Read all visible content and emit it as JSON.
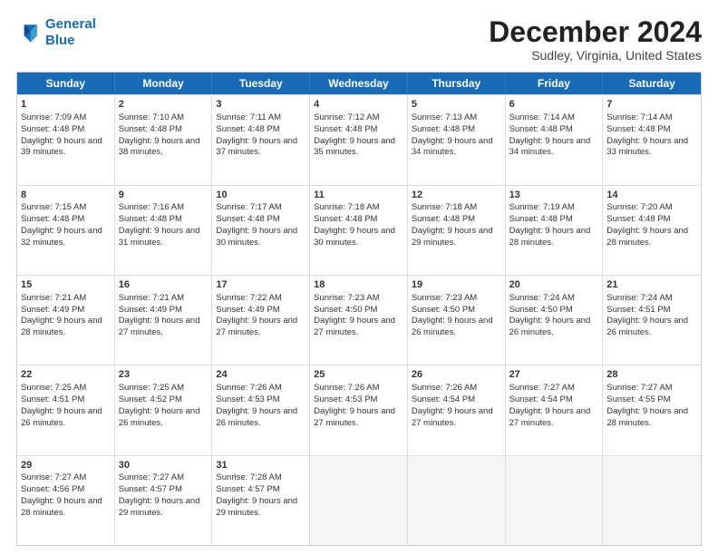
{
  "header": {
    "logo_line1": "General",
    "logo_line2": "Blue",
    "title": "December 2024",
    "subtitle": "Sudley, Virginia, United States"
  },
  "days": [
    "Sunday",
    "Monday",
    "Tuesday",
    "Wednesday",
    "Thursday",
    "Friday",
    "Saturday"
  ],
  "rows": [
    [
      {
        "day": "1",
        "sunrise": "7:09 AM",
        "sunset": "4:48 PM",
        "daylight": "9 hours and 39 minutes."
      },
      {
        "day": "2",
        "sunrise": "7:10 AM",
        "sunset": "4:48 PM",
        "daylight": "9 hours and 38 minutes."
      },
      {
        "day": "3",
        "sunrise": "7:11 AM",
        "sunset": "4:48 PM",
        "daylight": "9 hours and 37 minutes."
      },
      {
        "day": "4",
        "sunrise": "7:12 AM",
        "sunset": "4:48 PM",
        "daylight": "9 hours and 35 minutes."
      },
      {
        "day": "5",
        "sunrise": "7:13 AM",
        "sunset": "4:48 PM",
        "daylight": "9 hours and 34 minutes."
      },
      {
        "day": "6",
        "sunrise": "7:14 AM",
        "sunset": "4:48 PM",
        "daylight": "9 hours and 34 minutes."
      },
      {
        "day": "7",
        "sunrise": "7:14 AM",
        "sunset": "4:48 PM",
        "daylight": "9 hours and 33 minutes."
      }
    ],
    [
      {
        "day": "8",
        "sunrise": "7:15 AM",
        "sunset": "4:48 PM",
        "daylight": "9 hours and 32 minutes."
      },
      {
        "day": "9",
        "sunrise": "7:16 AM",
        "sunset": "4:48 PM",
        "daylight": "9 hours and 31 minutes."
      },
      {
        "day": "10",
        "sunrise": "7:17 AM",
        "sunset": "4:48 PM",
        "daylight": "9 hours and 30 minutes."
      },
      {
        "day": "11",
        "sunrise": "7:18 AM",
        "sunset": "4:48 PM",
        "daylight": "9 hours and 30 minutes."
      },
      {
        "day": "12",
        "sunrise": "7:18 AM",
        "sunset": "4:48 PM",
        "daylight": "9 hours and 29 minutes."
      },
      {
        "day": "13",
        "sunrise": "7:19 AM",
        "sunset": "4:48 PM",
        "daylight": "9 hours and 28 minutes."
      },
      {
        "day": "14",
        "sunrise": "7:20 AM",
        "sunset": "4:48 PM",
        "daylight": "9 hours and 28 minutes."
      }
    ],
    [
      {
        "day": "15",
        "sunrise": "7:21 AM",
        "sunset": "4:49 PM",
        "daylight": "9 hours and 28 minutes."
      },
      {
        "day": "16",
        "sunrise": "7:21 AM",
        "sunset": "4:49 PM",
        "daylight": "9 hours and 27 minutes."
      },
      {
        "day": "17",
        "sunrise": "7:22 AM",
        "sunset": "4:49 PM",
        "daylight": "9 hours and 27 minutes."
      },
      {
        "day": "18",
        "sunrise": "7:23 AM",
        "sunset": "4:50 PM",
        "daylight": "9 hours and 27 minutes."
      },
      {
        "day": "19",
        "sunrise": "7:23 AM",
        "sunset": "4:50 PM",
        "daylight": "9 hours and 26 minutes."
      },
      {
        "day": "20",
        "sunrise": "7:24 AM",
        "sunset": "4:50 PM",
        "daylight": "9 hours and 26 minutes."
      },
      {
        "day": "21",
        "sunrise": "7:24 AM",
        "sunset": "4:51 PM",
        "daylight": "9 hours and 26 minutes."
      }
    ],
    [
      {
        "day": "22",
        "sunrise": "7:25 AM",
        "sunset": "4:51 PM",
        "daylight": "9 hours and 26 minutes."
      },
      {
        "day": "23",
        "sunrise": "7:25 AM",
        "sunset": "4:52 PM",
        "daylight": "9 hours and 26 minutes."
      },
      {
        "day": "24",
        "sunrise": "7:26 AM",
        "sunset": "4:53 PM",
        "daylight": "9 hours and 26 minutes."
      },
      {
        "day": "25",
        "sunrise": "7:26 AM",
        "sunset": "4:53 PM",
        "daylight": "9 hours and 27 minutes."
      },
      {
        "day": "26",
        "sunrise": "7:26 AM",
        "sunset": "4:54 PM",
        "daylight": "9 hours and 27 minutes."
      },
      {
        "day": "27",
        "sunrise": "7:27 AM",
        "sunset": "4:54 PM",
        "daylight": "9 hours and 27 minutes."
      },
      {
        "day": "28",
        "sunrise": "7:27 AM",
        "sunset": "4:55 PM",
        "daylight": "9 hours and 28 minutes."
      }
    ],
    [
      {
        "day": "29",
        "sunrise": "7:27 AM",
        "sunset": "4:56 PM",
        "daylight": "9 hours and 28 minutes."
      },
      {
        "day": "30",
        "sunrise": "7:27 AM",
        "sunset": "4:57 PM",
        "daylight": "9 hours and 29 minutes."
      },
      {
        "day": "31",
        "sunrise": "7:28 AM",
        "sunset": "4:57 PM",
        "daylight": "9 hours and 29 minutes."
      },
      null,
      null,
      null,
      null
    ]
  ]
}
